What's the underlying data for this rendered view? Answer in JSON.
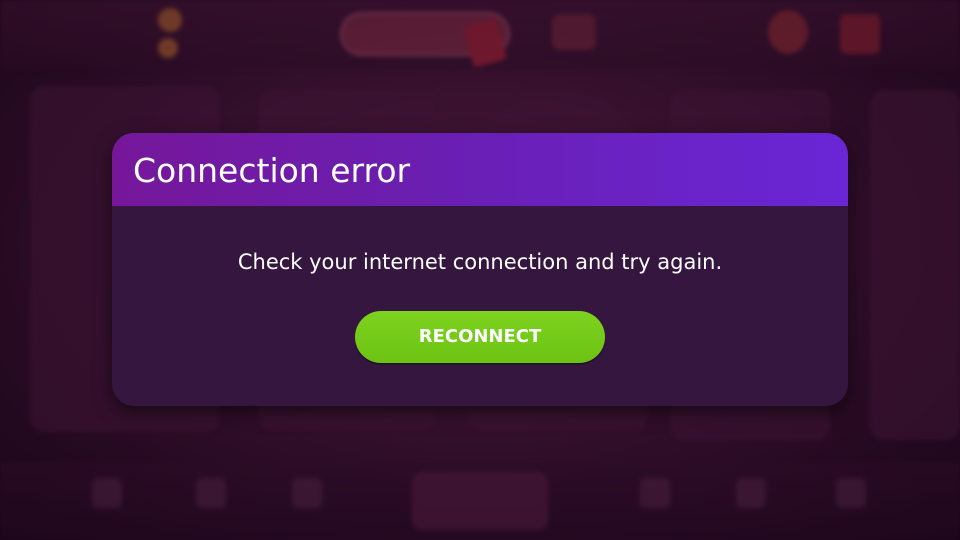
{
  "dialog": {
    "title": "Connection error",
    "message": "Check your internet connection and try again.",
    "reconnect_label": "RECONNECT"
  },
  "colors": {
    "header_accent": "#6a26d6",
    "dialog_body": "#34163f",
    "reconnect_button": "#74cc18",
    "text": "#ffffff"
  }
}
